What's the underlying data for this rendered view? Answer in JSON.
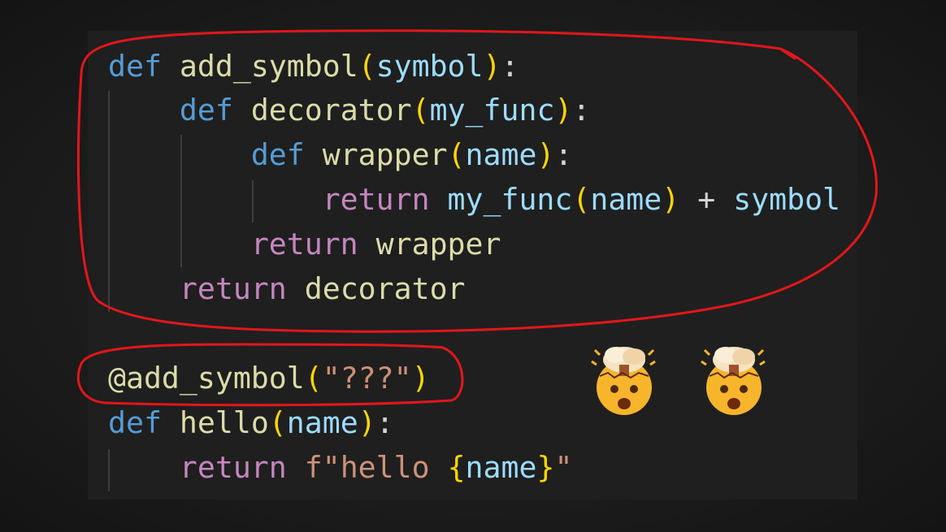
{
  "code": {
    "lines": [
      {
        "tokens": [
          {
            "t": "def",
            "c": "kw-def"
          },
          {
            "t": " "
          },
          {
            "t": "add_symbol",
            "c": "fn"
          },
          {
            "t": "(",
            "c": "brk"
          },
          {
            "t": "symbol",
            "c": "param"
          },
          {
            "t": ")",
            "c": "brk"
          },
          {
            "t": ":"
          }
        ]
      },
      {
        "tokens": [
          {
            "t": "    "
          },
          {
            "t": "def",
            "c": "kw-def"
          },
          {
            "t": " "
          },
          {
            "t": "decorator",
            "c": "fn"
          },
          {
            "t": "(",
            "c": "brk"
          },
          {
            "t": "my_func",
            "c": "param"
          },
          {
            "t": ")",
            "c": "brk"
          },
          {
            "t": ":"
          }
        ]
      },
      {
        "tokens": [
          {
            "t": "        "
          },
          {
            "t": "def",
            "c": "kw-def"
          },
          {
            "t": " "
          },
          {
            "t": "wrapper",
            "c": "fn"
          },
          {
            "t": "(",
            "c": "brk"
          },
          {
            "t": "name",
            "c": "param"
          },
          {
            "t": ")",
            "c": "brk"
          },
          {
            "t": ":"
          }
        ]
      },
      {
        "tokens": [
          {
            "t": "            "
          },
          {
            "t": "return",
            "c": "kw-ctl"
          },
          {
            "t": " "
          },
          {
            "t": "my_func",
            "c": "param"
          },
          {
            "t": "(",
            "c": "brk"
          },
          {
            "t": "name",
            "c": "param"
          },
          {
            "t": ")",
            "c": "brk"
          },
          {
            "t": " + ",
            "c": "op"
          },
          {
            "t": "symbol",
            "c": "param"
          }
        ]
      },
      {
        "tokens": [
          {
            "t": "        "
          },
          {
            "t": "return",
            "c": "kw-ctl"
          },
          {
            "t": " "
          },
          {
            "t": "wrapper",
            "c": "fn"
          }
        ]
      },
      {
        "tokens": [
          {
            "t": "    "
          },
          {
            "t": "return",
            "c": "kw-ctl"
          },
          {
            "t": " "
          },
          {
            "t": "decorator",
            "c": "fn"
          }
        ]
      },
      {
        "tokens": []
      },
      {
        "tokens": [
          {
            "t": "@add_symbol",
            "c": "fn"
          },
          {
            "t": "(",
            "c": "brk"
          },
          {
            "t": "\"???\"",
            "c": "str"
          },
          {
            "t": ")",
            "c": "brk"
          }
        ]
      },
      {
        "tokens": [
          {
            "t": "def",
            "c": "kw-def"
          },
          {
            "t": " "
          },
          {
            "t": "hello",
            "c": "fn"
          },
          {
            "t": "(",
            "c": "brk"
          },
          {
            "t": "name",
            "c": "param"
          },
          {
            "t": ")",
            "c": "brk"
          },
          {
            "t": ":"
          }
        ]
      },
      {
        "tokens": [
          {
            "t": "    "
          },
          {
            "t": "return",
            "c": "kw-ctl"
          },
          {
            "t": " "
          },
          {
            "t": "f\"hello ",
            "c": "str"
          },
          {
            "t": "{",
            "c": "brk"
          },
          {
            "t": "name",
            "c": "param"
          },
          {
            "t": "}",
            "c": "brk"
          },
          {
            "t": "\"",
            "c": "str"
          }
        ]
      }
    ]
  },
  "colors": {
    "annotation": "#e3161b",
    "background": "#1f1f1f",
    "keyword": "#569cd6",
    "control": "#c586c0",
    "function": "#dcdcaa",
    "parameter": "#9cdcfe",
    "bracket": "#ffd700",
    "string": "#ce9178"
  },
  "emojis": [
    {
      "name": "exploding-head-icon"
    },
    {
      "name": "exploding-head-icon"
    }
  ]
}
